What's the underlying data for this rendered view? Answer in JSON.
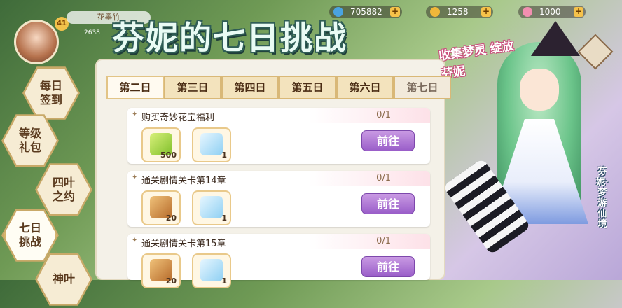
{
  "player": {
    "name": "花墨竹",
    "id_partial": "2638",
    "level": "41"
  },
  "resources": [
    {
      "label": "gems",
      "value": "705882",
      "color": "#4aa3e0"
    },
    {
      "label": "coins",
      "value": "1258",
      "color": "#f0b73a"
    },
    {
      "label": "stamina",
      "value": "1000",
      "color": "#f28fb0"
    }
  ],
  "title": "芬妮的七日挑战",
  "subtitle": "收集梦灵 绽放芬妮",
  "sidenav": [
    {
      "label": "每日\n签到",
      "active": false
    },
    {
      "label": "等级\n礼包",
      "active": false
    },
    {
      "label": "四叶\n之约",
      "active": false
    },
    {
      "label": "七日\n挑战",
      "active": true
    },
    {
      "label": "神叶",
      "active": false
    }
  ],
  "tabs": [
    {
      "label": "第二日",
      "active": true
    },
    {
      "label": "第三日",
      "active": false
    },
    {
      "label": "第四日",
      "active": false
    },
    {
      "label": "第五日",
      "active": false
    },
    {
      "label": "第六日",
      "active": false
    },
    {
      "label": "第七日",
      "active": false,
      "disabled": true
    }
  ],
  "tasks": [
    {
      "title": "购买奇妙花宝福利",
      "progress": "0/1",
      "rewards": [
        {
          "icon": "leaf-icon",
          "qty": "500"
        },
        {
          "icon": "crystal-icon",
          "qty": "1"
        }
      ],
      "button": "前往"
    },
    {
      "title": "通关剧情关卡第14章",
      "progress": "0/1",
      "rewards": [
        {
          "icon": "treasure-chest-icon",
          "qty": "20"
        },
        {
          "icon": "crystal-icon",
          "qty": "1"
        }
      ],
      "button": "前往"
    },
    {
      "title": "通关剧情关卡第15章",
      "progress": "0/1",
      "rewards": [
        {
          "icon": "treasure-chest-icon",
          "qty": "20"
        },
        {
          "icon": "crystal-icon",
          "qty": "1"
        }
      ],
      "button": "前往"
    }
  ],
  "character_name": "芬妮·梦游仙境",
  "colors": {
    "accent_purple": "#9a5ec9",
    "tab_gold": "#d9b877",
    "panel_bg": "#f4f1e8"
  }
}
